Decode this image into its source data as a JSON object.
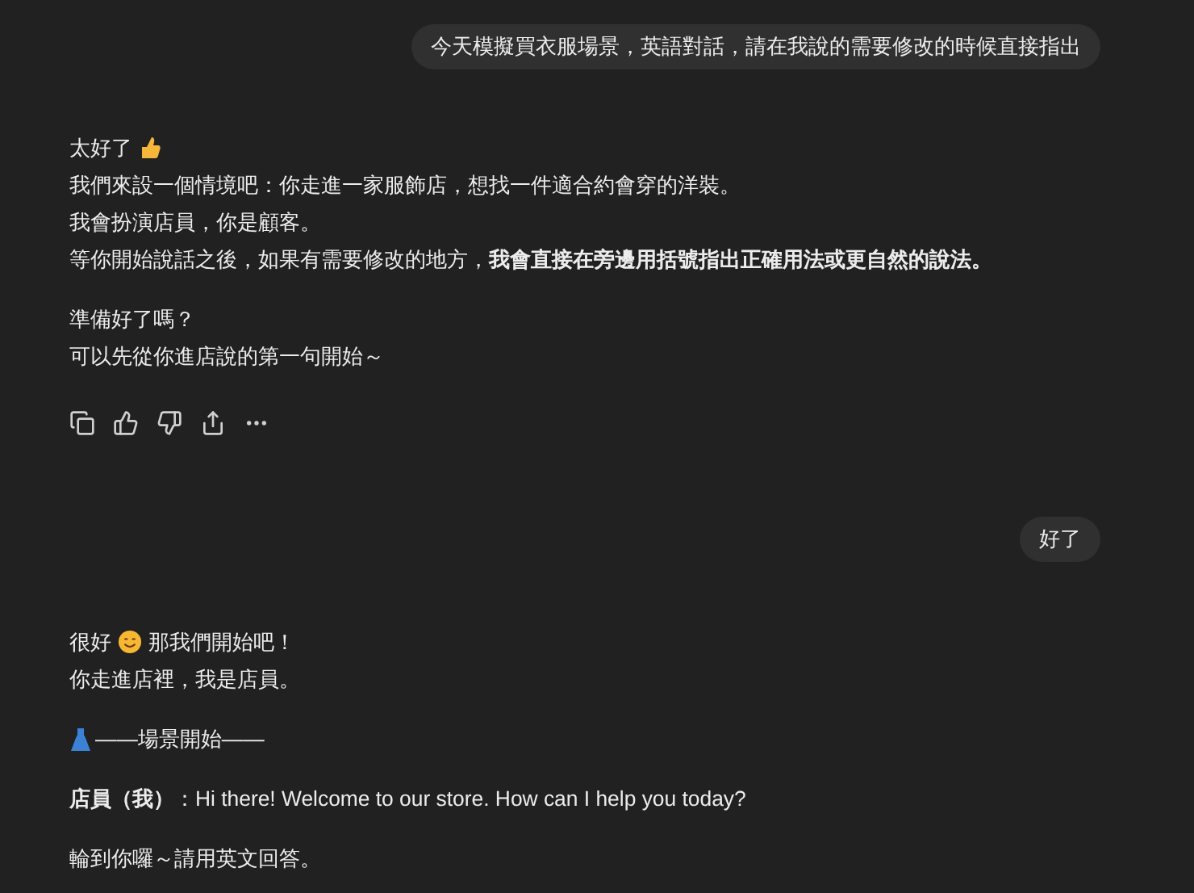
{
  "messages": [
    {
      "kind": "user",
      "text": "今天模擬買衣服場景，英語對話，請在我說的需要修改的時候直接指出"
    },
    {
      "kind": "assistant",
      "paragraphs": [
        [
          [
            {
              "kind": "text",
              "text": "太好了"
            },
            {
              "kind": "thumb"
            }
          ],
          [
            {
              "kind": "text",
              "text": "我們來設一個情境吧：你走進一家服飾店，想找一件適合約會穿的洋裝。"
            }
          ],
          [
            {
              "kind": "text",
              "text": "我會扮演店員，你是顧客。"
            }
          ],
          [
            {
              "kind": "text",
              "text": "等你開始說話之後，如果有需要修改的地方，**我會直接在旁邊用括號指出正確用法或更自然的說法。**"
            }
          ]
        ],
        [
          [
            {
              "kind": "text",
              "text": "準備好了嗎？"
            }
          ],
          [
            {
              "kind": "text",
              "text": "可以先從你進店說的第一句開始～"
            }
          ]
        ]
      ],
      "actions": true
    },
    {
      "kind": "user",
      "text": "好了"
    },
    {
      "kind": "assistant",
      "paragraphs": [
        [
          [
            {
              "kind": "text",
              "text": "很好"
            },
            {
              "kind": "smile"
            },
            {
              "kind": "text",
              "text": "那我們開始吧！"
            }
          ],
          [
            {
              "kind": "text",
              "text": "你走進店裡，我是店員。"
            }
          ]
        ],
        [
          [
            {
              "kind": "dress"
            },
            {
              "kind": "text",
              "text": "——場景開始——"
            }
          ]
        ],
        [
          [
            {
              "kind": "text",
              "text": "**店員（我）**：Hi there! Welcome to our store. How can I help you today?"
            }
          ]
        ],
        [
          [
            {
              "kind": "text",
              "text": "輪到你囉～請用英文回答。"
            }
          ]
        ]
      ],
      "actions": false
    }
  ]
}
